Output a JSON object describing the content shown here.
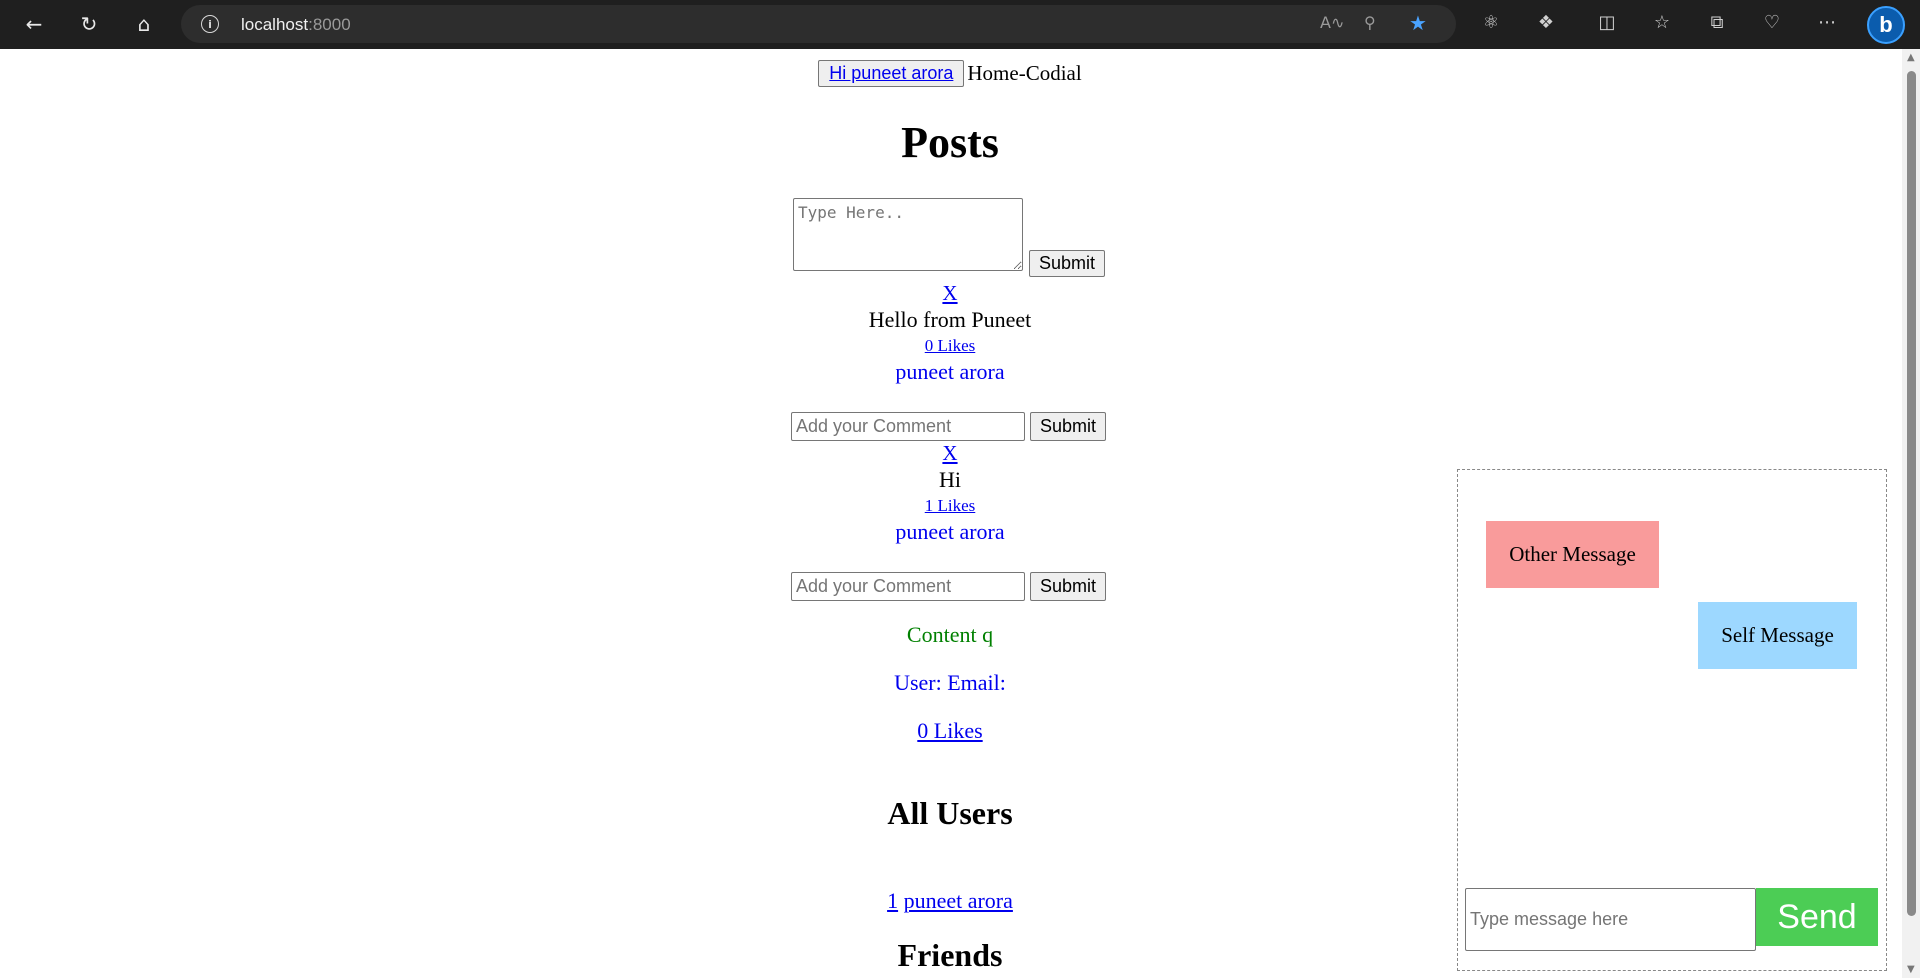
{
  "browser": {
    "url_host": "localhost",
    "url_port": ":8000"
  },
  "header": {
    "user_link": "Hi puneet arora",
    "brand": "Home-Codial"
  },
  "posts": {
    "title": "Posts",
    "textarea_placeholder": "Type Here..",
    "submit_label": "Submit",
    "items": [
      {
        "delete_label": "X",
        "content": "Hello from Puneet",
        "likes": "0 Likes",
        "author": "puneet arora",
        "comment_placeholder": "Add your Comment",
        "comment_submit": "Submit"
      },
      {
        "delete_label": "X",
        "content": "Hi",
        "likes": "1 Likes",
        "author": "puneet arora",
        "comment_placeholder": "Add your Comment",
        "comment_submit": "Submit"
      }
    ],
    "extra": {
      "content": "Content q",
      "user_email": "User: Email:",
      "likes": "0 Likes"
    }
  },
  "users": {
    "title": "All Users",
    "items": [
      {
        "index": "1",
        "name": "puneet arora"
      }
    ]
  },
  "friends": {
    "title": "Friends"
  },
  "chat": {
    "other_message": "Other Message",
    "self_message": "Self Message",
    "input_placeholder": "Type message here",
    "send_label": "Send"
  }
}
